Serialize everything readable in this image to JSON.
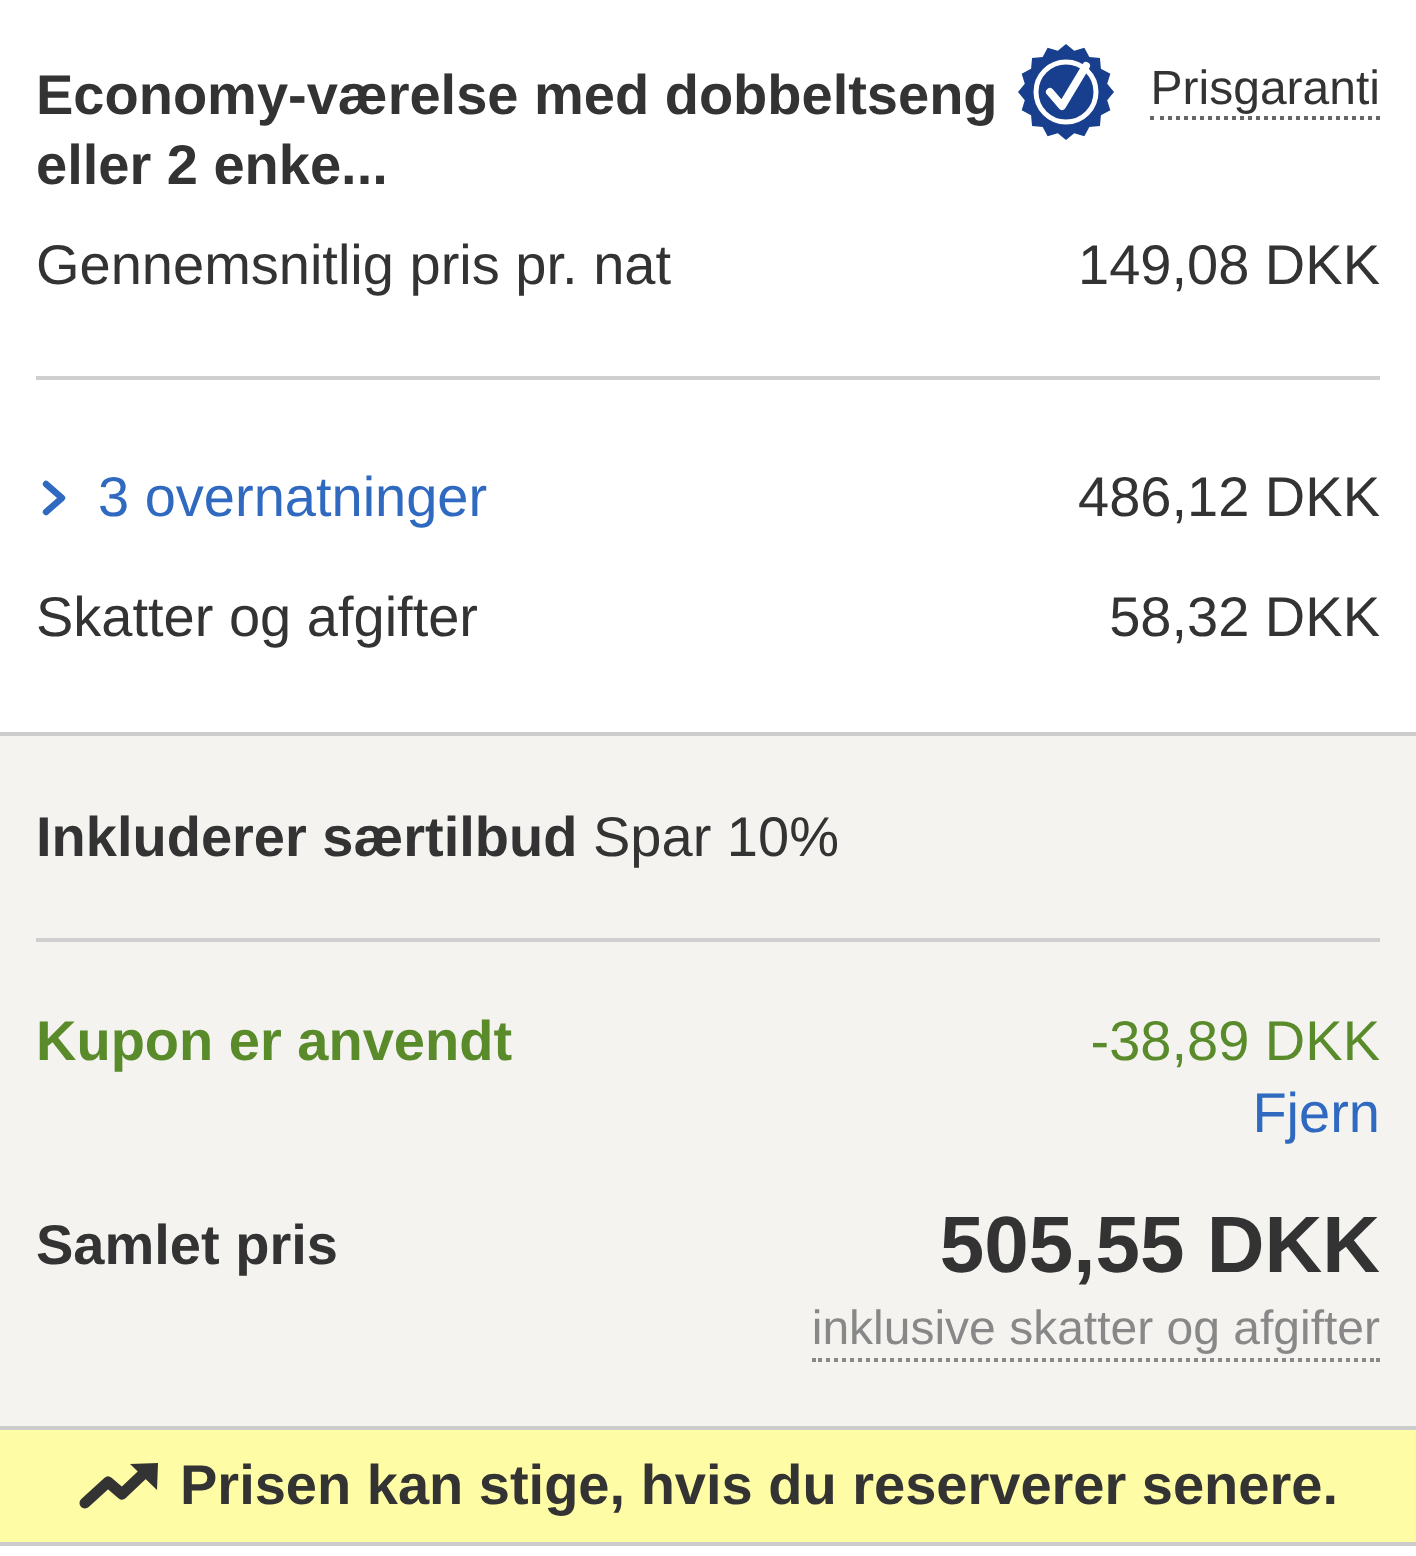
{
  "room": {
    "title": "Economy-værelse med dobbeltseng eller 2 enke...",
    "guarantee_link": "Prisgaranti"
  },
  "average_price": {
    "label": "Gennemsnitlig pris pr. nat",
    "value": "149,08 DKK"
  },
  "breakdown": [
    {
      "kind": "expandable",
      "label": "3 overnatninger",
      "value": "486,12 DKK",
      "expanded": false
    },
    {
      "kind": "plain",
      "label": "Skatter og afgifter",
      "value": "58,32 DKK"
    }
  ],
  "offer": {
    "text": "**Inkluderer særtilbud** Spar 10%"
  },
  "coupon": {
    "label": "Kupon er anvendt",
    "value": "-38,89 DKK",
    "action": "Fjern"
  },
  "total": {
    "label": "Samlet pris",
    "value": "505,55 DKK",
    "note": "inklusive skatter og afgifter"
  },
  "alert": {
    "text": "Prisen kan stige, hvis du reserverer senere."
  }
}
